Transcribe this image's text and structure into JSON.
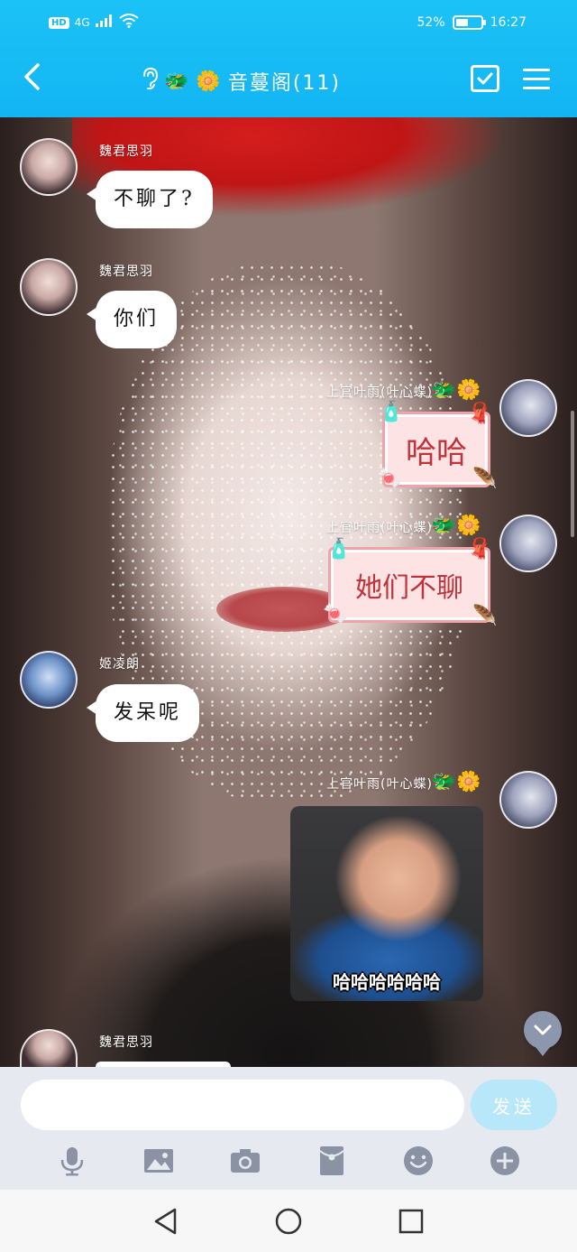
{
  "status_bar": {
    "hd_badge": "HD",
    "signal": "4G",
    "battery": "52%",
    "battery_level": 0.52,
    "time": "16:27"
  },
  "header": {
    "back_icon": "chevron-left-icon",
    "title": "音蔓阁(11)",
    "title_icons": [
      "ear-icon",
      "dragon-emoji",
      "flower-emoji"
    ],
    "calendar_icon": "calendar-check-icon",
    "menu_icon": "hamburger-menu-icon"
  },
  "messages": [
    {
      "sender": "魏君思羽",
      "side": "left",
      "type": "text",
      "text": "不聊了?"
    },
    {
      "sender": "魏君思羽",
      "side": "left",
      "type": "text",
      "text": "你们"
    },
    {
      "sender": "上官叶雨(叶心蝶)",
      "side": "right",
      "type": "sticker",
      "text": "哈哈"
    },
    {
      "sender": "上官叶雨(叶心蝶)",
      "side": "right",
      "type": "sticker",
      "text": "她们不聊"
    },
    {
      "sender": "姬凌朗",
      "side": "left",
      "type": "text",
      "text": "发呆呢"
    },
    {
      "sender": "上官叶雨(叶心蝶)",
      "side": "right",
      "type": "image",
      "text": "哈哈哈哈哈哈"
    },
    {
      "sender": "魏君思羽",
      "side": "left",
      "type": "text",
      "text": ""
    }
  ],
  "composer": {
    "input_value": "",
    "input_placeholder": "",
    "send_label": "发送",
    "tools": [
      "microphone-icon",
      "image-icon",
      "camera-icon",
      "red-packet-icon",
      "emoji-icon",
      "plus-icon"
    ]
  },
  "nav": {
    "buttons": [
      "back-triangle-icon",
      "home-circle-icon",
      "recents-square-icon"
    ]
  },
  "colors": {
    "header": "#13b5f3",
    "send_button": "#b8e7fa",
    "input_bar": "#e6e9f0",
    "sticker_text": "#c0333b"
  }
}
